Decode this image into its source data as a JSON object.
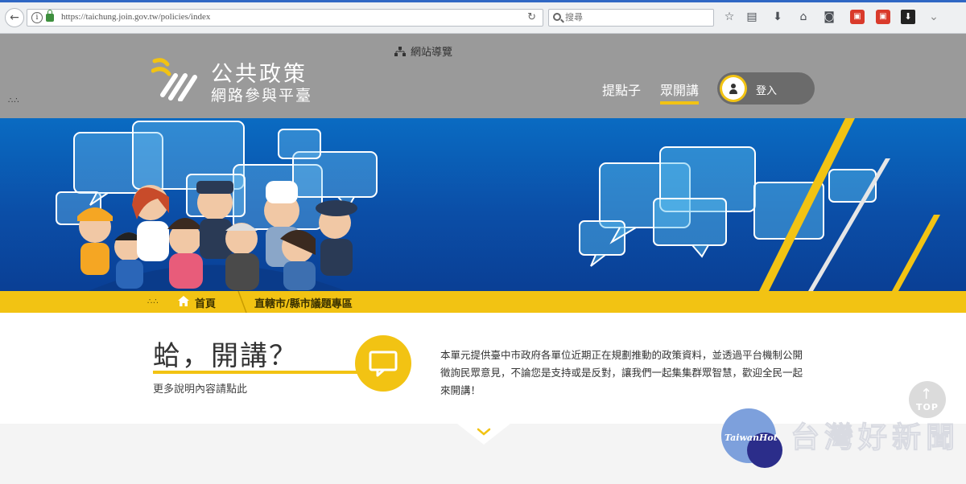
{
  "browser": {
    "url": "https://taichung.join.gov.tw/policies/index",
    "search_placeholder": "搜尋"
  },
  "header": {
    "logo_title": "公共政策",
    "logo_subtitle": "網路參與平臺",
    "sitemap_label": "網站導覽",
    "nav": [
      {
        "label": "提點子"
      },
      {
        "label": "眾開講"
      }
    ],
    "login_label": "登入"
  },
  "breadcrumb": {
    "home": "首頁",
    "current": "直轄市/縣市議題專區"
  },
  "content": {
    "heading": "蛤，開講？",
    "more_link": "更多說明內容請點此",
    "intro": "本單元提供臺中市政府各單位近期正在規劃推動的政策資料，並透過平台機制公開徵詢民眾意見，不論您是支持或是反對，讓我們一起集集群眾智慧，歡迎全民一起來開講！"
  },
  "top_button": {
    "label": "TOP"
  },
  "watermark": {
    "logo_text": "TaiwanHot",
    "text": "台灣好新聞"
  },
  "colors": {
    "accent": "#f2c313",
    "header_bg": "#9a9a9a",
    "banner": "#0b4ea7"
  }
}
